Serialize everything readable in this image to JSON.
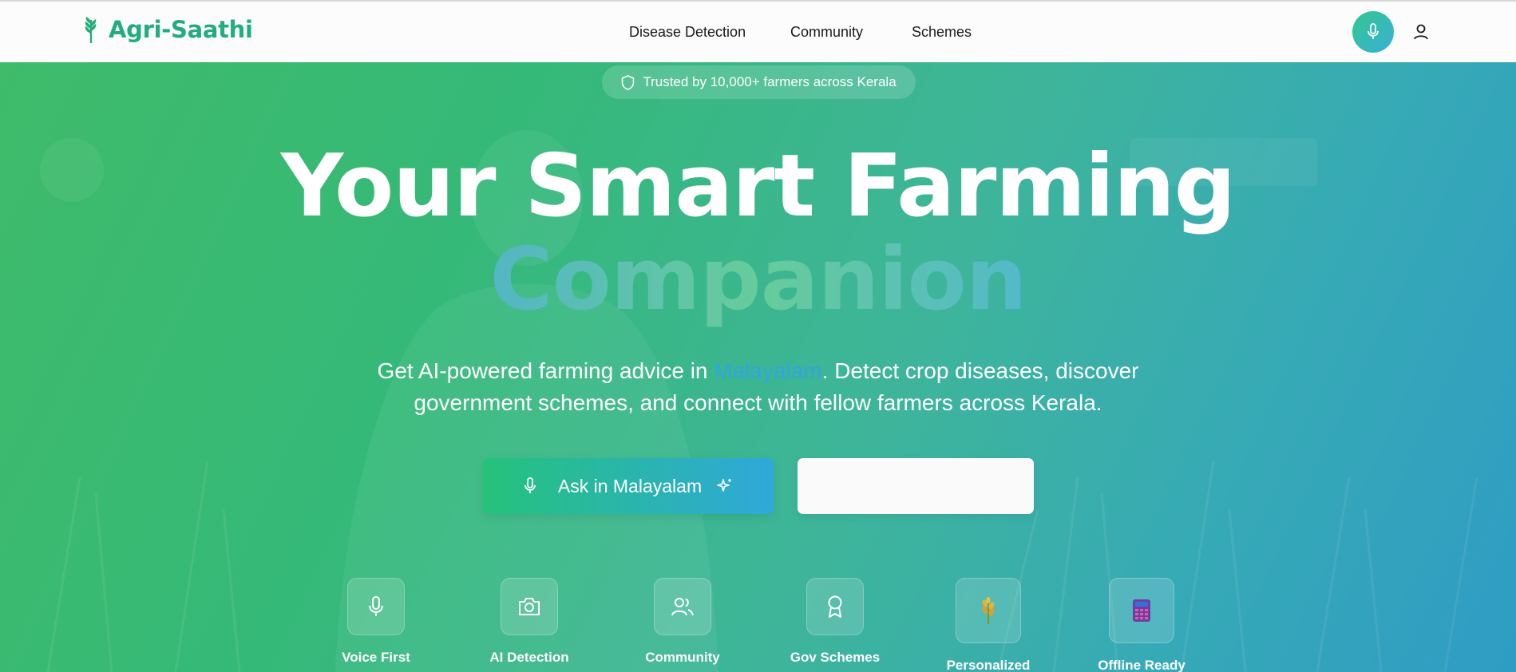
{
  "brand": {
    "name": "Agri-Saathi",
    "color": "#23ad7c"
  },
  "nav": {
    "items": [
      "Disease Detection",
      "Community",
      "Schemes"
    ]
  },
  "header_actions": {
    "mic_icon": "microphone-icon",
    "user_icon": "user-icon"
  },
  "hero": {
    "badge": "Trusted by 10,000+ farmers across Kerala",
    "headline_line1": "Your Smart Farming",
    "headline_line2": "Companion",
    "subtitle_before": "Get AI-powered farming advice in ",
    "subtitle_highlight": "Malayalam",
    "subtitle_after": ". Detect crop diseases, discover government schemes, and connect with fellow farmers across Kerala.",
    "primary_button": "Ask in Malayalam",
    "secondary_button": ""
  },
  "features": [
    {
      "label": "Voice First",
      "icon": "microphone-icon"
    },
    {
      "label": "AI Detection",
      "icon": "camera-icon"
    },
    {
      "label": "Community",
      "icon": "users-icon"
    },
    {
      "label": "Gov Schemes",
      "icon": "award-icon"
    },
    {
      "label": "Personalized",
      "icon": "wheat-emoji-icon"
    },
    {
      "label": "Offline Ready",
      "icon": "calculator-emoji-icon"
    }
  ],
  "colors": {
    "accent_green": "#25c27a",
    "accent_blue": "#2fa8db",
    "highlight": "#2fa6e2"
  }
}
